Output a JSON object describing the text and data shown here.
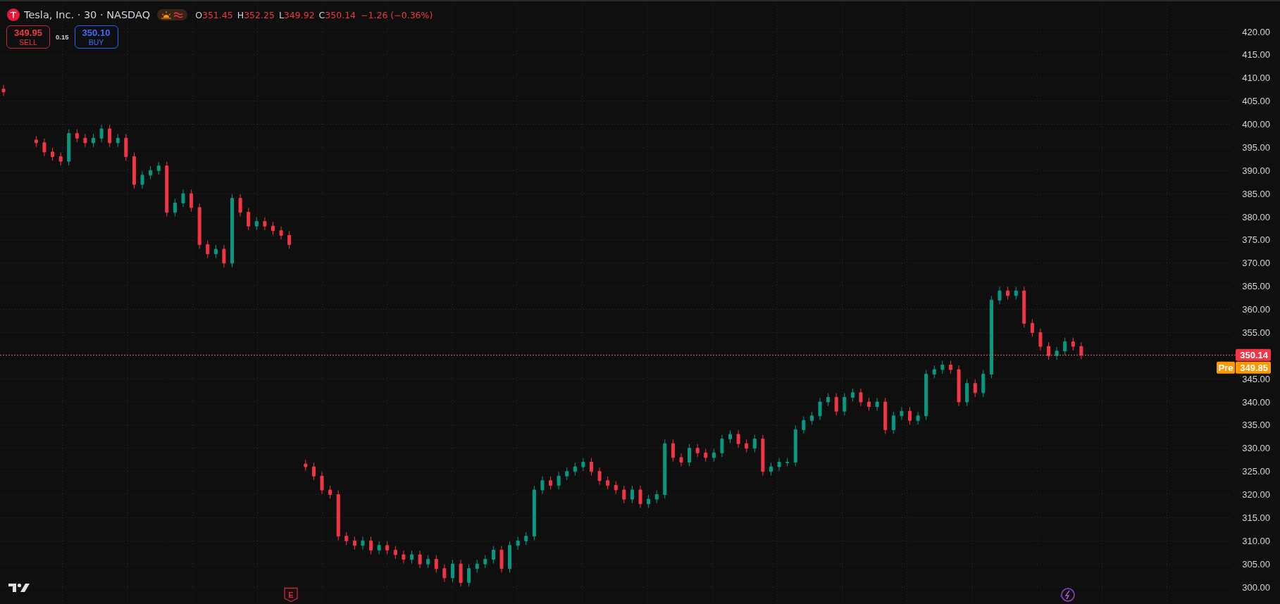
{
  "header": {
    "title": "Tesla, Inc. · 30 · NASDAQ",
    "ohlc": [
      {
        "label": "O",
        "value": "351.45"
      },
      {
        "label": "H",
        "value": "352.25"
      },
      {
        "label": "L",
        "value": "349.92"
      },
      {
        "label": "C",
        "value": "350.14"
      }
    ],
    "change": "−1.26 (−0.36%)"
  },
  "trade": {
    "sell": {
      "price": "349.95",
      "label": "SELL"
    },
    "spread": "0.15",
    "buy": {
      "price": "350.10",
      "label": "BUY"
    }
  },
  "price_axis": {
    "ticks": [
      "420.00",
      "415.00",
      "410.00",
      "405.00",
      "400.00",
      "395.00",
      "390.00",
      "385.00",
      "380.00",
      "375.00",
      "370.00",
      "365.00",
      "360.00",
      "355.00",
      "345.00",
      "340.00",
      "335.00",
      "330.00",
      "325.00",
      "320.00",
      "315.00",
      "310.00",
      "305.00",
      "300.00"
    ],
    "last_price": "350.14",
    "pre_label": "Pre",
    "pre_price": "349.85"
  },
  "earnings_marker": "E"
}
